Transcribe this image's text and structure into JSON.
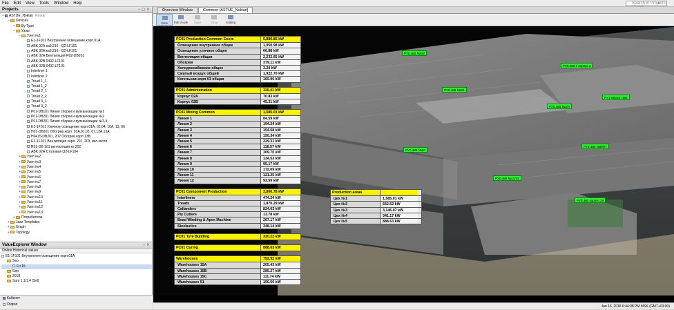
{
  "menu": {
    "items": [
      "File",
      "Edit",
      "View",
      "Tools",
      "Window",
      "Help"
    ],
    "search_placeholder": "Search in Projects (Ctrl+I)"
  },
  "projects": {
    "title": "Projects",
    "tree": [
      {
        "label": "ASTUE_Nokian",
        "extra": "Ready",
        "indent": 0,
        "icon": "node",
        "toggle": "−"
      },
      {
        "label": "Devices",
        "indent": 1,
        "icon": "fold",
        "toggle": "−"
      },
      {
        "label": "By Type",
        "indent": 2,
        "icon": "fold",
        "toggle": "+"
      },
      {
        "label": "Узлы",
        "indent": 2,
        "icon": "fold",
        "toggle": "−"
      },
      {
        "label": "Узел №1",
        "indent": 3,
        "icon": "fold",
        "toggle": "−"
      },
      {
        "label": "E1-1F101 Внутреннее освещение корп.01А",
        "indent": 4,
        "icon": "fil"
      },
      {
        "label": "ABK 02А каб.216 - Q2-LF101",
        "indent": 4,
        "icon": "fil"
      },
      {
        "label": "ABK 02А каб.216 - Q2-LF101",
        "indent": 4,
        "icon": "fil"
      },
      {
        "label": "ABK 02А Вентиляция R02-DB201",
        "indent": 4,
        "icon": "fil"
      },
      {
        "label": "ABK 02В 0402-LF101",
        "indent": 4,
        "icon": "fil"
      },
      {
        "label": "ABK 02В 0402-LF101",
        "indent": 4,
        "icon": "fil"
      },
      {
        "label": "Interliner 1",
        "indent": 4,
        "icon": "fil"
      },
      {
        "label": "Interliner 2",
        "indent": 4,
        "icon": "fil"
      },
      {
        "label": "Tread 1_1",
        "indent": 4,
        "icon": "fil"
      },
      {
        "label": "Tread 1_2",
        "indent": 4,
        "icon": "fil"
      },
      {
        "label": "Tread 2_1",
        "indent": 4,
        "icon": "fil"
      },
      {
        "label": "Tread 2_2",
        "indent": 4,
        "icon": "fil"
      },
      {
        "label": "Tread 3_1",
        "indent": 4,
        "icon": "fil"
      },
      {
        "label": "Tread 3_2",
        "indent": 4,
        "icon": "fil"
      },
      {
        "label": "P01-DB101 Линия сборки и вулканизации №1",
        "indent": 4,
        "icon": "fil"
      },
      {
        "label": "P01-DB201 Линия сборки и вулканизации №2",
        "indent": 4,
        "icon": "fil"
      },
      {
        "label": "P01-DB201 Линия сборки и вулканизации №3,4",
        "indent": 4,
        "icon": "fil"
      },
      {
        "label": "E1-1F101 Уличное освещение корп.01А, 02,04, 10А, 13, 06",
        "indent": 4,
        "icon": "fil"
      },
      {
        "label": "H01-DB201 Обогрев корп. 01А,01,03, 07,13А,13А",
        "indent": 4,
        "icon": "fil"
      },
      {
        "label": "H0415-DB201, 202 Обогрев корп.13В",
        "indent": 4,
        "icon": "fil"
      },
      {
        "label": "E1-1F101 Вентиляция корп. 201, 203, вкл.экспл.",
        "indent": 4,
        "icon": "fil"
      },
      {
        "label": "R01-DB 101 вентиляция кп 202",
        "indent": 4,
        "icon": "fil"
      },
      {
        "label": "ABK 02А Столовая Q2-LF104",
        "indent": 4,
        "icon": "fil"
      },
      {
        "label": "Узел №2",
        "indent": 3,
        "icon": "fold",
        "toggle": "+"
      },
      {
        "label": "Узел №3",
        "indent": 3,
        "icon": "fold",
        "toggle": "+"
      },
      {
        "label": "Узел №4",
        "indent": 3,
        "icon": "fold",
        "toggle": "+"
      },
      {
        "label": "Узел №5",
        "indent": 3,
        "icon": "fold",
        "toggle": "+"
      },
      {
        "label": "Узел №6",
        "indent": 3,
        "icon": "fold",
        "toggle": "+"
      },
      {
        "label": "Узел №7",
        "indent": 3,
        "icon": "fold",
        "toggle": "+"
      },
      {
        "label": "Узел №8",
        "indent": 3,
        "icon": "fold",
        "toggle": "+"
      },
      {
        "label": "Узел №9",
        "indent": 3,
        "icon": "fold",
        "toggle": "+"
      },
      {
        "label": "Узел №10",
        "indent": 3,
        "icon": "fold",
        "toggle": "+"
      },
      {
        "label": "Узел №11",
        "indent": 3,
        "icon": "fold",
        "toggle": "+"
      },
      {
        "label": "Узел №12",
        "indent": 3,
        "icon": "fold",
        "toggle": "+"
      },
      {
        "label": "Узел №13",
        "indent": 3,
        "icon": "fold",
        "toggle": "+"
      },
      {
        "label": "Потребители",
        "indent": 2,
        "icon": "fold",
        "toggle": "+"
      },
      {
        "label": "Jazz Templates",
        "indent": 1,
        "icon": "fold",
        "toggle": "+"
      },
      {
        "label": "Graph",
        "indent": 1,
        "icon": "fold",
        "toggle": "+"
      },
      {
        "label": "Topology",
        "indent": 1,
        "icon": "fold",
        "toggle": "+"
      }
    ]
  },
  "value_explorer": {
    "title": "ValueExplorer Window",
    "tabs": "Online  Historical values",
    "items": [
      {
        "label": "E1-1F101 Внутреннее освещение корп.01А",
        "indent": 0,
        "icon": "fil"
      },
      {
        "label": "Sep",
        "indent": 1,
        "icon": "fold"
      },
      {
        "label": "Fri 15",
        "indent": 2,
        "icon": "fil"
      },
      {
        "label": "Sep",
        "indent": 1,
        "icon": "fold"
      },
      {
        "label": "2018",
        "indent": 1,
        "icon": "fold"
      },
      {
        "label": "Sum 1,1/1,4 [Sel]",
        "indent": 1,
        "icon": "fold"
      }
    ]
  },
  "bottom": {
    "item1": "Кабинет",
    "item2": "Output"
  },
  "tabs": [
    "Overview Window",
    "Common [ASTUE_Nokian]"
  ],
  "toolbar": [
    {
      "label": "View mode",
      "state": "on"
    },
    {
      "label": "Edit mode",
      "state": "normal"
    },
    {
      "label": "Save",
      "state": "dis"
    },
    {
      "label": "Snap",
      "state": "dis"
    },
    {
      "label": "Scaling",
      "state": "normal"
    }
  ],
  "cost_tables": [
    {
      "name": "PC01 Production Common Costs",
      "value": "5,880.85 kW",
      "rows": [
        [
          "Освещение внутреннее общее",
          "1,050.98 kW"
        ],
        [
          "Освещение уличное общее",
          "66.88 kW"
        ],
        [
          "Вентиляция общая",
          "2,232.65 kW"
        ],
        [
          "Обогрев",
          "379.11 kW"
        ],
        [
          "Холодоснабжение общее",
          "3.20 kW"
        ],
        [
          "Сжатый воздух общий",
          "1,922.70 kW"
        ],
        [
          "Котельная корп 03 общая",
          "165.90 kW"
        ]
      ]
    },
    {
      "name": "PC01 Administration",
      "value": "116.41 kW",
      "rows": [
        [
          "Корпус 02А",
          "70.83 kW"
        ],
        [
          "Корпус 02В",
          "45.31 kW"
        ]
      ]
    },
    {
      "name": "PC01 Mixing Common",
      "value": "1,585.01 kW",
      "rows": [
        [
          "Линия 1",
          "84.59 kW"
        ],
        [
          "Линия 2",
          "194.24 kW"
        ],
        [
          "Линия 3",
          "154.58 kW"
        ],
        [
          "Линия 4",
          "150.34 kW"
        ],
        [
          "Линия 5",
          "229.31 kW"
        ],
        [
          "Линия 6",
          "118.57 kW"
        ],
        [
          "Линия 7",
          "109.70 kW"
        ],
        [
          "Линия 8",
          "134.53 kW"
        ],
        [
          "Линия 9",
          "95.17 kW"
        ],
        [
          "Линия 10",
          "172.09 kW"
        ],
        [
          "Линия 11",
          "121.25 kW"
        ],
        [
          "Линия 12",
          "93.59 kW"
        ]
      ]
    },
    {
      "name": "PC01 Component Production",
      "value": "3,800.78 kW",
      "rows": [
        [
          "Interliners",
          "474.24 kW"
        ],
        [
          "Treads",
          "1,870.29 kW"
        ],
        [
          "Callanders",
          "824.63 kW"
        ],
        [
          "Ply Cutters",
          "13.78 kW"
        ],
        [
          "Bead Winding & Apex Machine",
          "267.17 kW"
        ],
        [
          "Steelastics",
          "348.14 kW"
        ]
      ]
    },
    {
      "name": "PC01 Tyre Building",
      "value": "320.22 kW",
      "rows": []
    },
    {
      "name": "PC01 Curing",
      "value": "888.63 kW",
      "rows": []
    },
    {
      "name": "Warehouses",
      "value": "752.92 kW",
      "rows": [
        [
          "Warehouses 15A",
          "205.43 kW"
        ],
        [
          "Warehouses 15B",
          "285.27 kW"
        ],
        [
          "Warehouses 15C",
          "111.74 kW"
        ],
        [
          "Warehouses 51",
          "150.50 kW"
        ]
      ]
    }
  ],
  "production_areas": {
    "name": "Production areas",
    "rows": [
      [
        "Цех №1",
        "1,585.01 kW"
      ],
      [
        "Цех №2",
        "652.52 kW"
      ],
      [
        "Цех №3",
        "3,146.07 kW"
      ],
      [
        "Цех №4",
        "341.17 kW"
      ],
      [
        "Цех №5",
        "888.63 kW"
      ]
    ]
  },
  "tags": [
    {
      "label": "РУ0.4кВ №5/2"
    },
    {
      "label": "РУ0.4кВ 4 корпус.а"
    },
    {
      "label": "РУ0.4кВ №5/1"
    },
    {
      "label": "РУ0.4кВ №3/4"
    },
    {
      "label": "РУ1-0В181+182"
    },
    {
      "label": "РУ0.4кВ №5/6/7"
    },
    {
      "label": "РУ0.4кВ №10"
    },
    {
      "label": "РУ0.4кВ №11/12"
    },
    {
      "label": "РУ0.4кВ корпус.34"
    }
  ],
  "status": {
    "time": "Jan 16, 2018 6:44:08 PM MSK (GMT+03:00)",
    "overview": "Overview"
  },
  "colors": {
    "header_yellow": "#fff200",
    "tag_green": "#33ee33",
    "toolbar_active": "#c8dbf2"
  }
}
